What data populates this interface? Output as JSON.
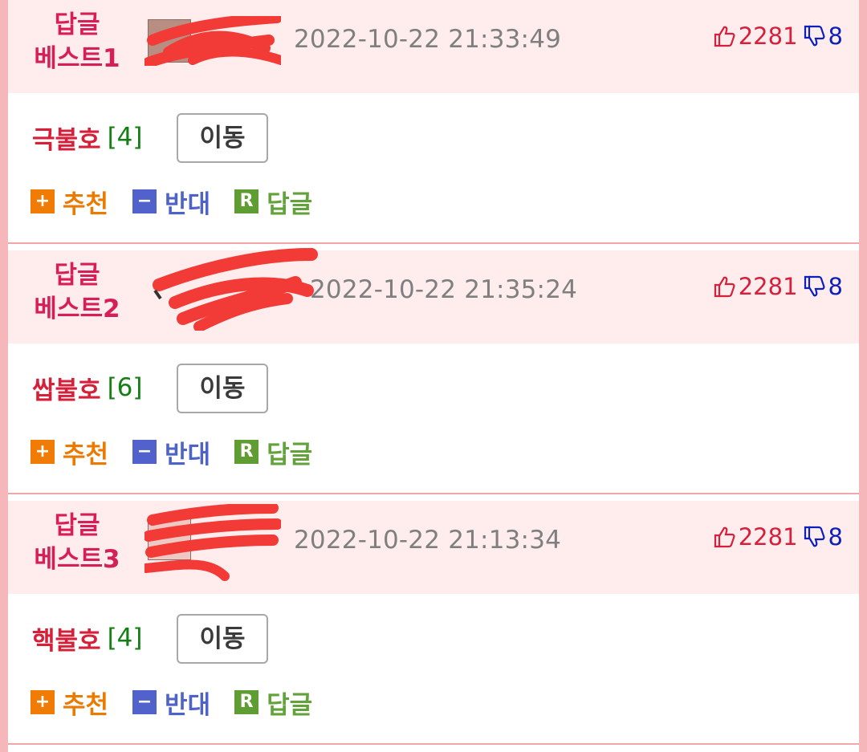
{
  "posts": [
    {
      "best_label": "답글\n베스트1",
      "datetime": "2022-10-22 21:33:49",
      "up_count": "2281",
      "down_count": "8",
      "title": "극불호",
      "reply_count": "[4]",
      "move_label": "이동"
    },
    {
      "best_label": "답글\n베스트2",
      "datetime": "2022-10-22 21:35:24",
      "up_count": "2281",
      "down_count": "8",
      "title": "쌉불호",
      "reply_count": "[6]",
      "move_label": "이동"
    },
    {
      "best_label": "답글\n베스트3",
      "datetime": "2022-10-22 21:13:34",
      "up_count": "2281",
      "down_count": "8",
      "title": "핵불호",
      "reply_count": "[4]",
      "move_label": "이동"
    }
  ],
  "actions": {
    "recommend_label": "추천",
    "oppose_label": "반대",
    "reply_label": "답글",
    "recommend_icon": "+",
    "oppose_icon": "−",
    "reply_icon": "R"
  },
  "colors": {
    "accent": "#d61f57",
    "header_bg": "#ffeced",
    "separator": "#f1a7aa",
    "page_bg": "#f6b7ba"
  }
}
